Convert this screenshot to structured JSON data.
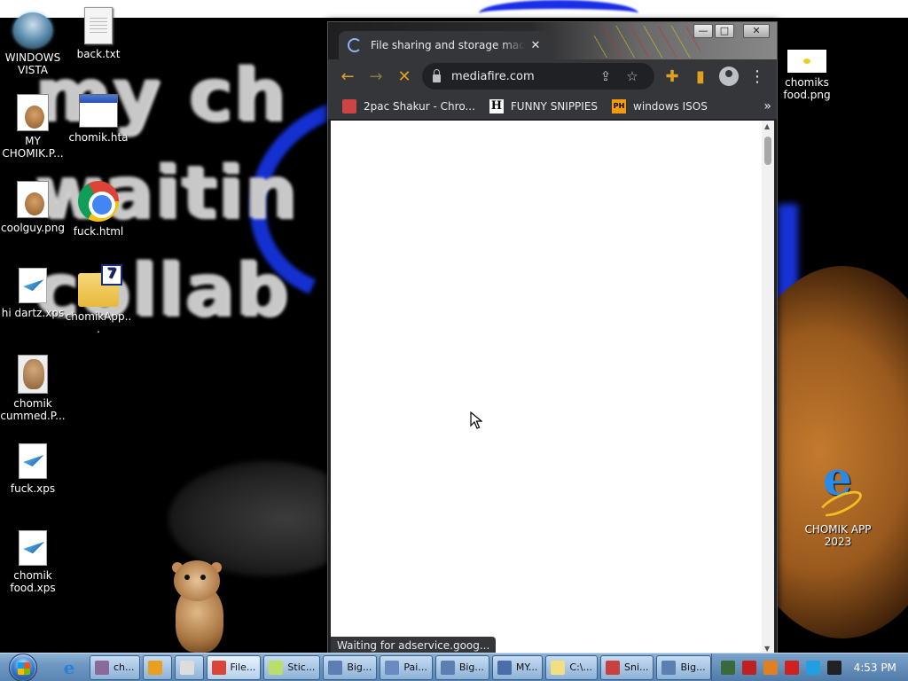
{
  "wallpaper": {
    "text_lines": [
      "my ch",
      "waitin",
      "collab"
    ]
  },
  "desktop": {
    "icons": [
      {
        "label": "WINDOWS VISTA",
        "icon": "vista-icon"
      },
      {
        "label": "back.txt",
        "icon": "text-file-icon"
      },
      {
        "label": "MY CHOMIK.P...",
        "icon": "image-file-icon"
      },
      {
        "label": "chomik.hta",
        "icon": "hta-file-icon"
      },
      {
        "label": "coolguy.png",
        "icon": "image-file-icon"
      },
      {
        "label": "fuck.html",
        "icon": "chrome-icon"
      },
      {
        "label": "hi dartz.xps",
        "icon": "xps-file-icon"
      },
      {
        "label": "chomikApp...",
        "icon": "folder-icon"
      },
      {
        "label": "chomik cummed.P...",
        "icon": "hamster-image-icon"
      },
      {
        "label": "fuck.xps",
        "icon": "xps-file-icon"
      },
      {
        "label": "chomik food.xps",
        "icon": "xps-file-icon"
      },
      {
        "label": "chomiks food.png",
        "icon": "image-file-icon"
      },
      {
        "label": "CHOMIK APP 2023",
        "icon": "internet-explorer-icon"
      }
    ]
  },
  "browser": {
    "tab": {
      "title": "File sharing and storage made si",
      "close": "✕"
    },
    "window_buttons": {
      "minimize": "—",
      "maximize": "□",
      "close": "✕"
    },
    "toolbar": {
      "back": "←",
      "forward": "→",
      "stop": "✕",
      "url": "mediafire.com",
      "share": "⇪",
      "star": "☆",
      "extensions": "✚",
      "sidepanel": "▮",
      "menu": "⋮"
    },
    "bookmarks": [
      {
        "label": "2pac Shakur - Chro...",
        "icon_text": ""
      },
      {
        "label": "FUNNY SNIPPIES",
        "icon_text": "H"
      },
      {
        "label": "windows ISOS",
        "icon_text": "PH"
      }
    ],
    "bookmarks_overflow": "»",
    "scroll": {
      "up": "▲",
      "down": "▼"
    },
    "status": "Waiting for adservice.goog..."
  },
  "taskbar": {
    "quick_launch_ie": "e",
    "items": [
      {
        "label": "ch...",
        "color": "#8a6a9a",
        "active": false
      },
      {
        "label": "",
        "color": "#e8a020",
        "active": false
      },
      {
        "label": "",
        "color": "#dddddd",
        "active": false
      },
      {
        "label": "File...",
        "color": "#db4437",
        "active": true
      },
      {
        "label": "Stic...",
        "color": "#b8e068",
        "active": false
      },
      {
        "label": "Big...",
        "color": "#5a7fb0",
        "active": false
      },
      {
        "label": "Pai...",
        "color": "#6a8ac0",
        "active": false
      },
      {
        "label": "Big...",
        "color": "#5a7fb0",
        "active": false
      },
      {
        "label": "MY...",
        "color": "#4a6ea8",
        "active": false
      },
      {
        "label": "C:\\...",
        "color": "#f0e080",
        "active": false
      },
      {
        "label": "Sni...",
        "color": "#c84040",
        "active": false
      },
      {
        "label": "Big...",
        "color": "#5a7fb0",
        "active": false
      }
    ],
    "tray_icons": [
      "#3a6a3a",
      "#c02020",
      "#e08020",
      "#d02020",
      "#20a0e0",
      "#222222"
    ],
    "clock": "4:53 PM"
  }
}
